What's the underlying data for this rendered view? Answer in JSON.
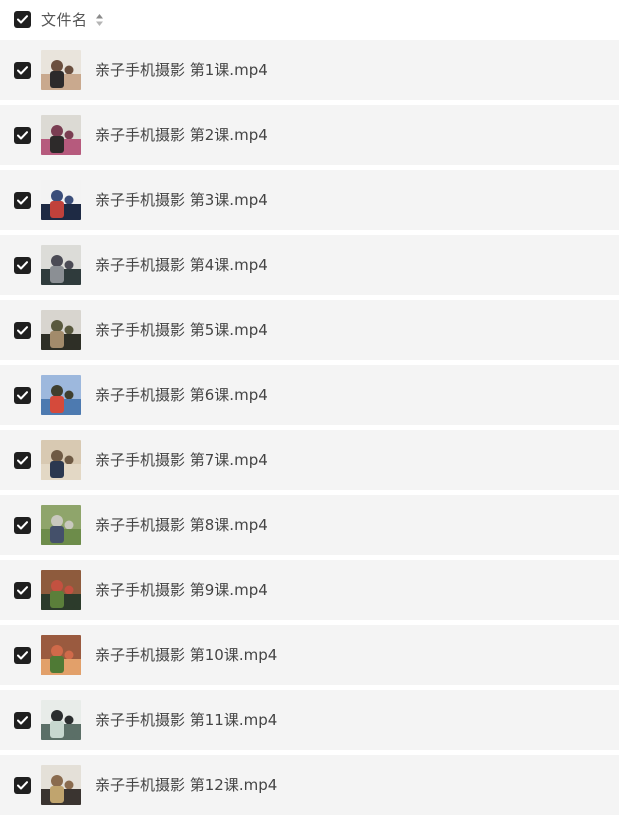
{
  "header": {
    "checked": true,
    "label": "文件名",
    "sort_icon": "sort-updown-icon"
  },
  "files": [
    {
      "name": "亲子手机摄影 第1课.mp4",
      "checked": true,
      "thumbnail": "video-thumbnail"
    },
    {
      "name": "亲子手机摄影 第2课.mp4",
      "checked": true,
      "thumbnail": "video-thumbnail"
    },
    {
      "name": "亲子手机摄影 第3课.mp4",
      "checked": true,
      "thumbnail": "video-thumbnail"
    },
    {
      "name": "亲子手机摄影 第4课.mp4",
      "checked": true,
      "thumbnail": "video-thumbnail"
    },
    {
      "name": "亲子手机摄影 第5课.mp4",
      "checked": true,
      "thumbnail": "video-thumbnail"
    },
    {
      "name": "亲子手机摄影 第6课.mp4",
      "checked": true,
      "thumbnail": "video-thumbnail"
    },
    {
      "name": "亲子手机摄影 第7课.mp4",
      "checked": true,
      "thumbnail": "video-thumbnail"
    },
    {
      "name": "亲子手机摄影 第8课.mp4",
      "checked": true,
      "thumbnail": "video-thumbnail"
    },
    {
      "name": "亲子手机摄影 第9课.mp4",
      "checked": true,
      "thumbnail": "video-thumbnail"
    },
    {
      "name": "亲子手机摄影 第10课.mp4",
      "checked": true,
      "thumbnail": "video-thumbnail"
    },
    {
      "name": "亲子手机摄影 第11课.mp4",
      "checked": true,
      "thumbnail": "video-thumbnail"
    },
    {
      "name": "亲子手机摄影 第12课.mp4",
      "checked": true,
      "thumbnail": "video-thumbnail"
    }
  ],
  "colors": {
    "checkbox": "#1f1f1f",
    "row_background": "#f4f4f4",
    "text": "#444444"
  }
}
